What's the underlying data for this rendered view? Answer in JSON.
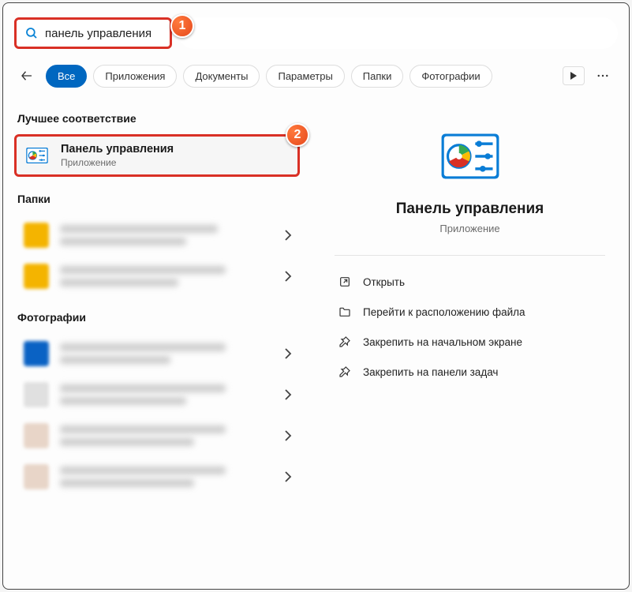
{
  "search": {
    "value": "панель управления"
  },
  "tabs": {
    "all": "Все",
    "apps": "Приложения",
    "docs": "Документы",
    "settings": "Параметры",
    "folders": "Папки",
    "photos": "Фотографии"
  },
  "left": {
    "best_match": "Лучшее соответствие",
    "folders": "Папки",
    "photos": "Фотографии",
    "result": {
      "name": "Панель управления",
      "sub": "Приложение"
    }
  },
  "detail": {
    "title": "Панель управления",
    "sub": "Приложение",
    "actions": {
      "open": "Открыть",
      "location": "Перейти к расположению файла",
      "pin_start": "Закрепить на начальном экране",
      "pin_taskbar": "Закрепить на панели задач"
    }
  },
  "badges": {
    "b1": "1",
    "b2": "2"
  }
}
